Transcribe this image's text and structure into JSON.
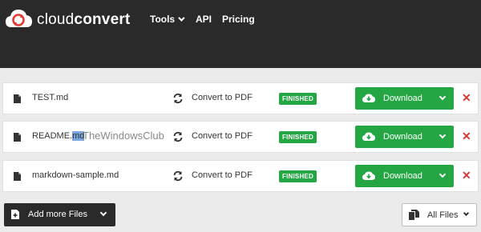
{
  "brand": {
    "name_light": "cloud",
    "name_bold": "convert"
  },
  "nav": [
    {
      "label": "Tools",
      "has_dropdown": true
    },
    {
      "label": "API"
    },
    {
      "label": "Pricing"
    }
  ],
  "files": [
    {
      "name": "TEST.md",
      "conversion": "Convert to PDF",
      "status": "FINISHED",
      "download_label": "Download"
    },
    {
      "name_prefix": "README.",
      "name_highlight": "md",
      "watermark": "TheWindowsClub",
      "conversion": "Convert to PDF",
      "status": "FINISHED",
      "download_label": "Download"
    },
    {
      "name": "markdown-sample.md",
      "conversion": "Convert to PDF",
      "status": "FINISHED",
      "download_label": "Download"
    }
  ],
  "footer": {
    "add_files_label": "Add more Files",
    "all_files_label": "All Files"
  },
  "icons": [
    "cloudconvert-logo-icon",
    "file-icon",
    "refresh-icon",
    "cloud-download-icon",
    "close-icon",
    "file-plus-icon",
    "files-icon",
    "chevron-down-icon"
  ],
  "colors": {
    "header_bg": "#2a2a2a",
    "success": "#24a645",
    "danger": "#d03a3a",
    "page_bg": "#ebebeb",
    "logo_red": "#e53935"
  }
}
